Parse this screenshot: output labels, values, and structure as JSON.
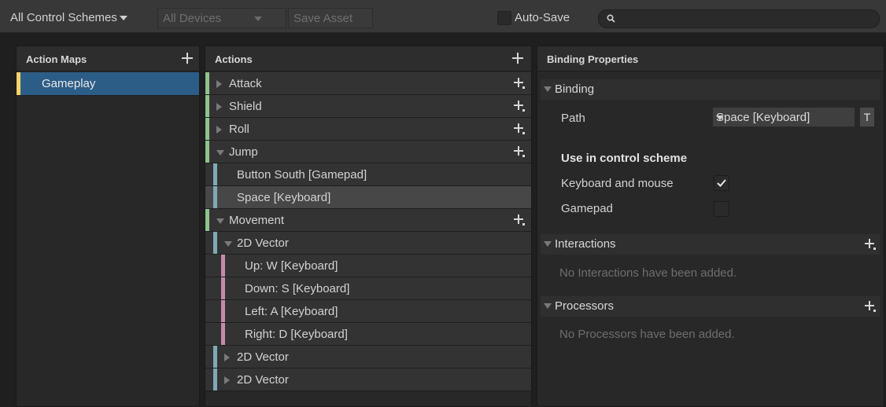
{
  "toolbar": {
    "control_schemes": "All Control Schemes",
    "devices": "All Devices",
    "save_asset": "Save Asset",
    "auto_save": "Auto-Save",
    "search_placeholder": ""
  },
  "action_maps": {
    "title": "Action Maps",
    "items": [
      {
        "label": "Gameplay",
        "selected": true
      }
    ]
  },
  "actions": {
    "title": "Actions",
    "rows": [
      {
        "label": "Attack",
        "kind": "action",
        "expanded": false
      },
      {
        "label": "Shield",
        "kind": "action",
        "expanded": false
      },
      {
        "label": "Roll",
        "kind": "action",
        "expanded": false
      },
      {
        "label": "Jump",
        "kind": "action",
        "expanded": true
      },
      {
        "label": "Button South [Gamepad]",
        "kind": "binding"
      },
      {
        "label": "Space [Keyboard]",
        "kind": "binding",
        "selected": true
      },
      {
        "label": "Movement",
        "kind": "action",
        "expanded": true
      },
      {
        "label": "2D Vector",
        "kind": "composite",
        "expanded": true
      },
      {
        "label": "Up: W [Keyboard]",
        "kind": "part"
      },
      {
        "label": "Down: S [Keyboard]",
        "kind": "part"
      },
      {
        "label": "Left: A [Keyboard]",
        "kind": "part"
      },
      {
        "label": "Right: D [Keyboard]",
        "kind": "part"
      },
      {
        "label": "2D Vector",
        "kind": "composite",
        "expanded": false
      },
      {
        "label": "2D Vector",
        "kind": "composite",
        "expanded": false
      }
    ]
  },
  "binding_properties": {
    "title": "Binding Properties",
    "binding_section": "Binding",
    "path_label": "Path",
    "path_value": "Space [Keyboard]",
    "t_button": "T",
    "use_in_scheme": "Use in control scheme",
    "schemes": [
      {
        "label": "Keyboard and mouse",
        "checked": true
      },
      {
        "label": "Gamepad",
        "checked": false
      }
    ],
    "interactions_section": "Interactions",
    "interactions_empty": "No Interactions have been added.",
    "processors_section": "Processors",
    "processors_empty": "No Processors have been added."
  },
  "colors": {
    "selected_row": "#2c5d87",
    "map_bar": "#f4d36b",
    "action_bar": "#8fc38d",
    "binding_bar": "#7fa9b4",
    "part_bar": "#c68aa8",
    "selected_binding_row": "#474747"
  }
}
